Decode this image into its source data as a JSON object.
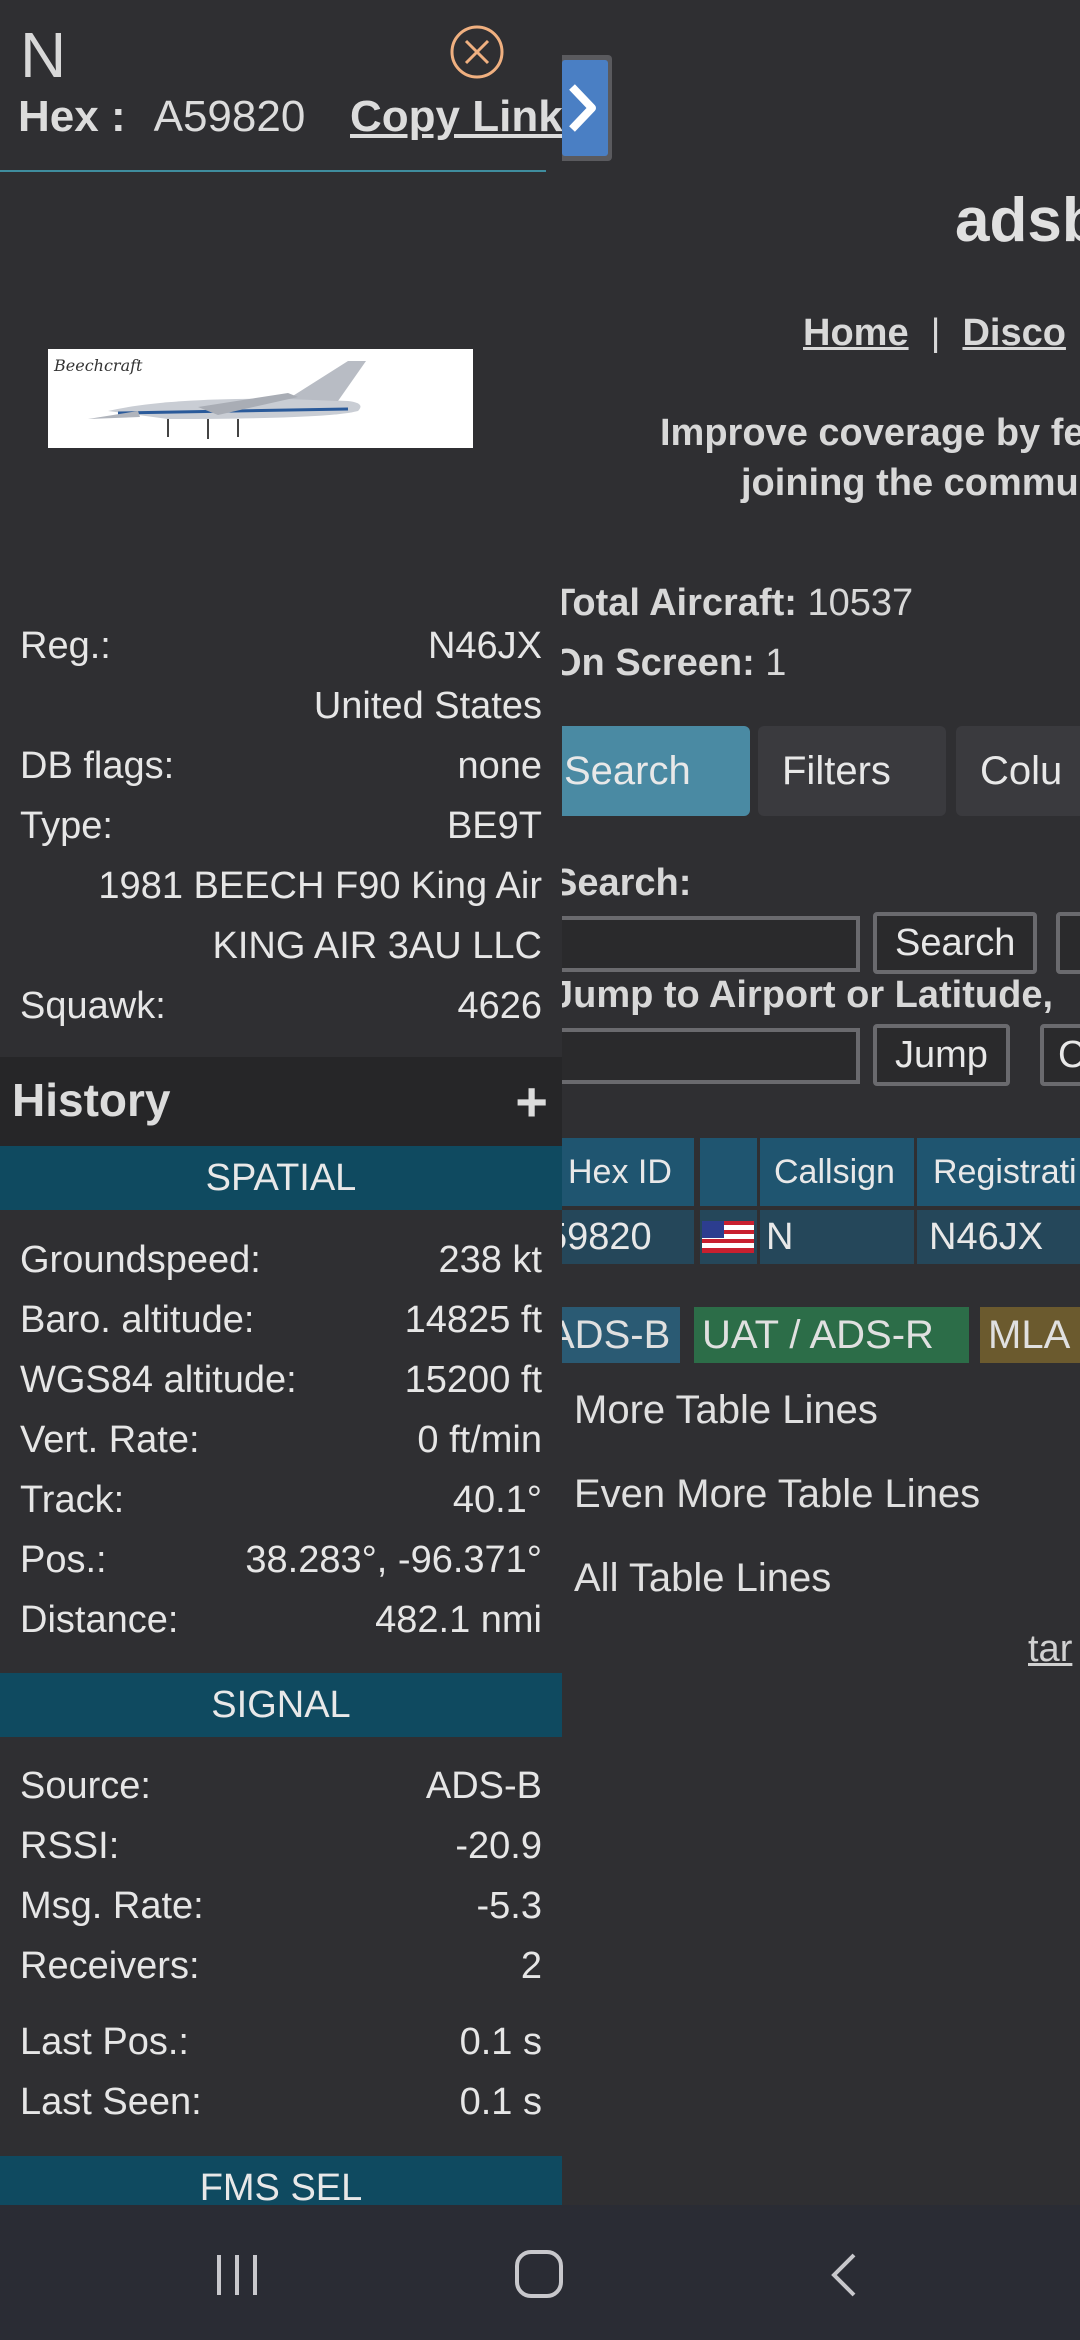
{
  "right_page": {
    "title": "adsb",
    "nav": {
      "home": "Home",
      "sep": "|",
      "discord": "Disco"
    },
    "improve_line1": "Improve coverage by fe",
    "improve_line2": "joining the commu",
    "total_label": "Total Aircraft:",
    "total_value": "10537",
    "onscreen_label": "On Screen:",
    "onscreen_value": "1",
    "tabs": [
      "Search",
      "Filters",
      "Colu"
    ],
    "search_label": "Search:",
    "search_button": "Search",
    "jump_label": "Jump to Airport or Latitude,",
    "jump_button": "Jump",
    "table": {
      "headers": [
        "Hex ID",
        "",
        "Callsign",
        "Registrati"
      ],
      "row": {
        "hex": "59820",
        "callsign": "N",
        "registration": "N46JX"
      }
    },
    "badges": [
      "ADS-B",
      "UAT / ADS-R",
      "MLA"
    ],
    "checkboxes": [
      "More Table Lines",
      "Even More Table Lines",
      "All Table Lines"
    ],
    "link": "tar"
  },
  "panel": {
    "callsign": "N",
    "hex_label": "Hex :",
    "hex_value": "A59820",
    "copy_link": "Copy Link",
    "info": [
      {
        "label": "Reg.:",
        "value": "N46JX"
      },
      {
        "label": "",
        "value": "United States"
      },
      {
        "label": "DB flags:",
        "value": "none"
      },
      {
        "label": "Type:",
        "value": "BE9T"
      },
      {
        "label": "",
        "value": "1981 BEECH F90 King Air"
      },
      {
        "label": "",
        "value": "KING AIR 3AU LLC"
      },
      {
        "label": "Squawk:",
        "value": "4626"
      }
    ],
    "history_label": "History",
    "history_toggle": "+",
    "spatial_title": "SPATIAL",
    "spatial": [
      {
        "label": "Groundspeed:",
        "value": "238 kt"
      },
      {
        "label": "Baro. altitude:",
        "value": "14825 ft"
      },
      {
        "label": "WGS84 altitude:",
        "value": "15200 ft"
      },
      {
        "label": "Vert. Rate:",
        "value": "0 ft/min"
      },
      {
        "label": "Track:",
        "value": "40.1°"
      },
      {
        "label": "Pos.:",
        "value": "38.283°, -96.371°"
      },
      {
        "label": "Distance:",
        "value": "482.1 nmi"
      }
    ],
    "signal_title": "SIGNAL",
    "signal": [
      {
        "label": "Source:",
        "value": "ADS-B"
      },
      {
        "label": "RSSI:",
        "value": "-20.9"
      },
      {
        "label": "Msg. Rate:",
        "value": "-5.3"
      },
      {
        "label": "Receivers:",
        "value": "2"
      },
      {
        "label": "Last Pos.:",
        "value": "0.1 s"
      },
      {
        "label": "Last Seen:",
        "value": "0.1 s"
      }
    ],
    "fms_title": "FMS SEL"
  },
  "colors": {
    "background": "#2f2f32",
    "section_header": "#0f4a60",
    "tab_active": "#4a8aa3",
    "close_icon": "#f0b080",
    "badge_adsb": "#2a5a73",
    "badge_uat": "#2c6d48",
    "badge_mlat": "#6b5a2e"
  },
  "icons": [
    "expand-right-icon",
    "close-icon",
    "us-flag-icon",
    "recent-apps-icon",
    "home-icon",
    "back-icon"
  ]
}
